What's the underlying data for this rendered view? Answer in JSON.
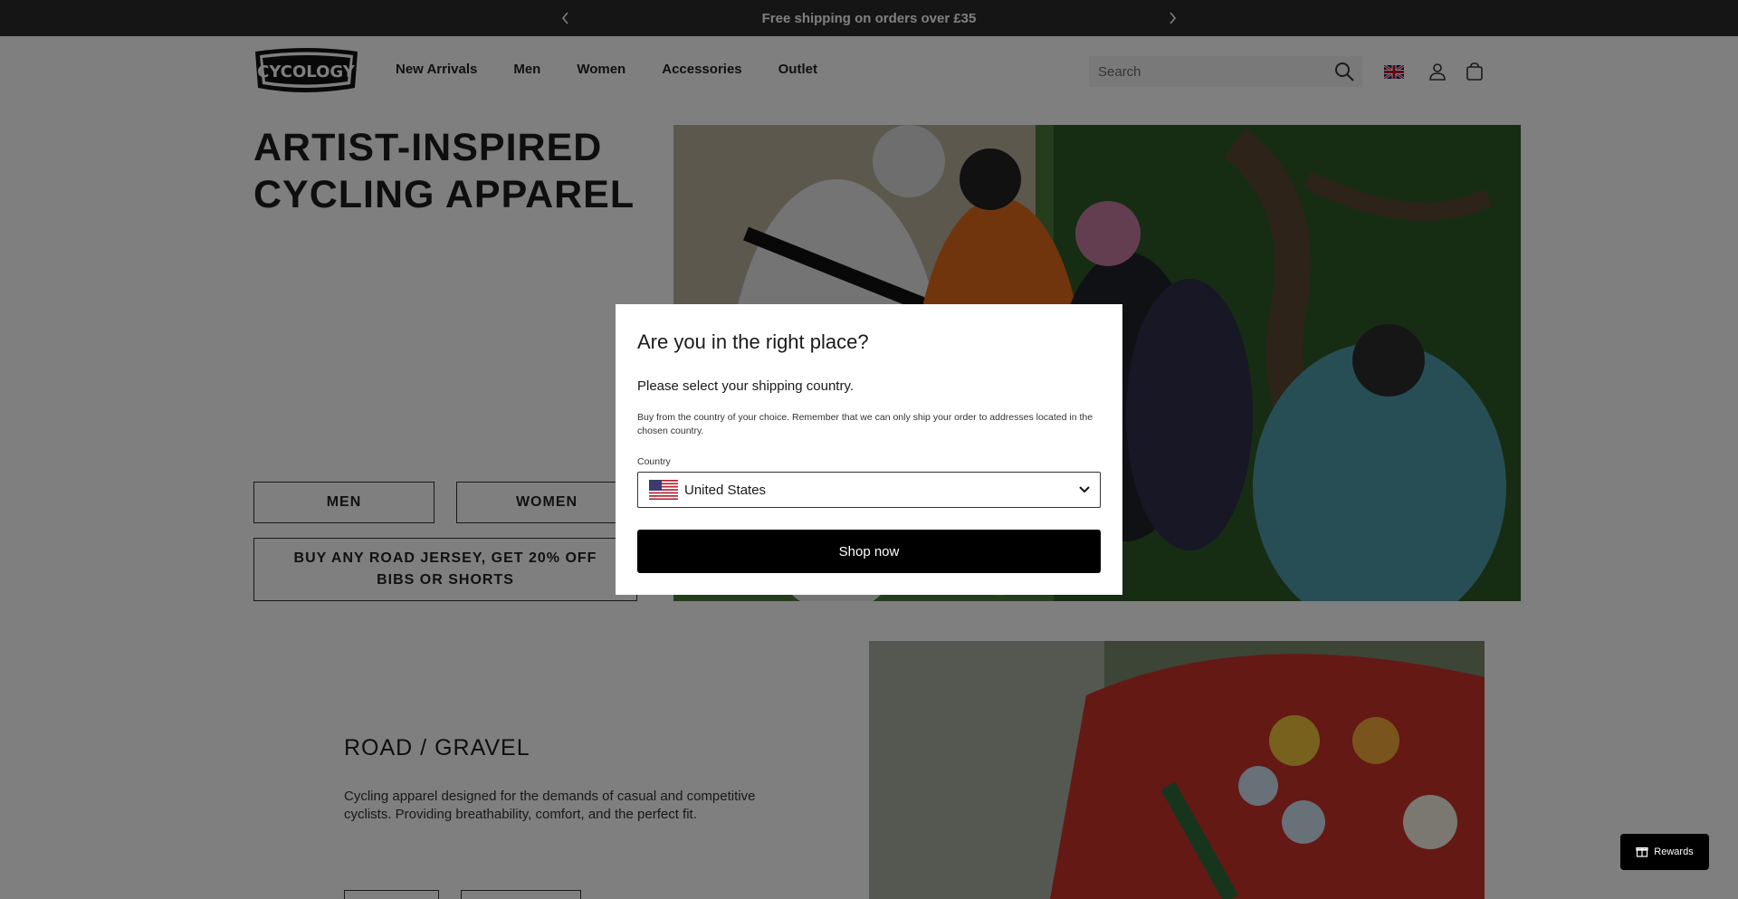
{
  "announcement": {
    "text": "Free shipping on orders over £35"
  },
  "header": {
    "nav": [
      "New Arrivals",
      "Men",
      "Women",
      "Accessories",
      "Outlet"
    ],
    "search_placeholder": "Search"
  },
  "hero": {
    "title_line1": "ARTIST-INSPIRED",
    "title_line2": "CYCLING APPAREL",
    "btn_men": "MEN",
    "btn_women": "WOMEN",
    "promo": "BUY ANY ROAD JERSEY, GET 20% OFF BIBS OR SHORTS"
  },
  "section": {
    "title": "ROAD / GRAVEL",
    "text": "Cycling apparel designed for the demands of casual and competitive cyclists. Providing breathability, comfort, and the perfect fit."
  },
  "modal": {
    "title": "Are you in the right place?",
    "subtitle": "Please select your shipping country.",
    "note": "Buy from the country of your choice. Remember that we can only ship your order to addresses located in the chosen country.",
    "country_label": "Country",
    "country_value": "United States",
    "button": "Shop now"
  },
  "rewards": {
    "label": "Rewards"
  },
  "icons": [
    "chevron-left-icon",
    "chevron-right-icon",
    "search-icon",
    "uk-flag-icon",
    "user-icon",
    "cart-icon",
    "us-flag-icon",
    "chevron-down-icon",
    "gift-icon"
  ]
}
